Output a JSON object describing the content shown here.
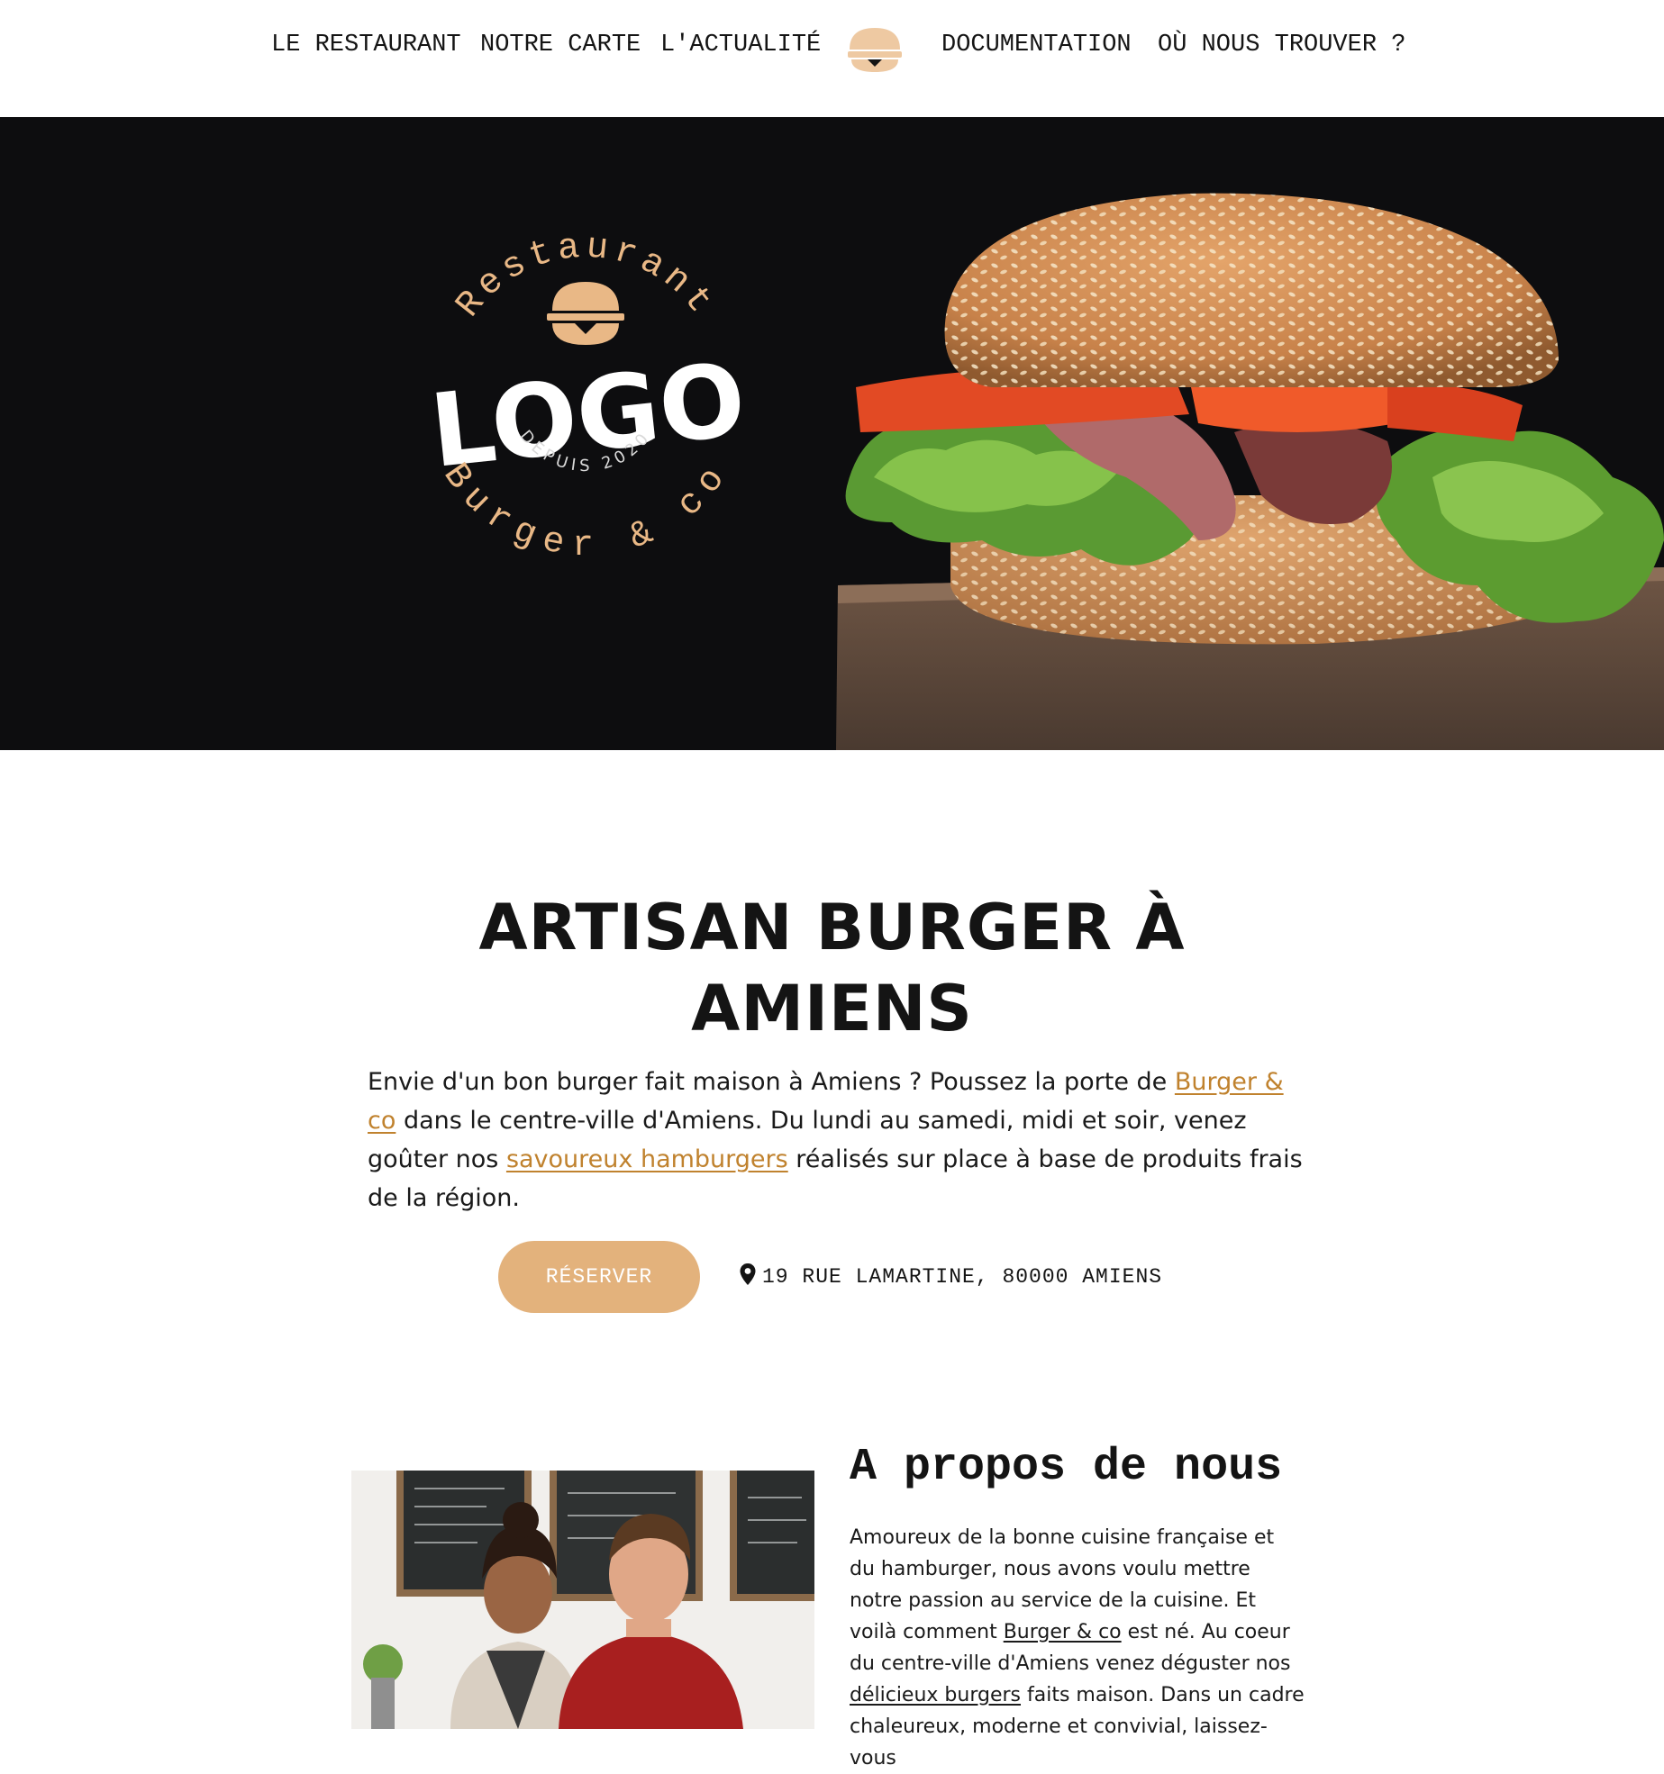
{
  "nav": {
    "items": [
      {
        "label": "LE RESTAURANT"
      },
      {
        "label": "NOTRE CARTE"
      },
      {
        "label": "L'ACTUALITÉ"
      },
      {
        "label": "DOCUMENTATION"
      },
      {
        "label": "OÙ NOUS TROUVER ?"
      }
    ],
    "logo_icon": "burger-icon"
  },
  "hero": {
    "logo": {
      "top_arc": "Restaurant",
      "main": "LOGO",
      "since": "DEPUIS 2020",
      "bottom_arc": "Burger & co"
    }
  },
  "intro": {
    "title_line1": "ARTISAN BURGER À",
    "title_line2": "AMIENS",
    "text_1": "Envie d'un bon burger fait maison à Amiens ? Poussez la porte de ",
    "link_1": "Burger & co",
    "text_2": " dans le centre-ville d'Amiens. Du lundi au samedi, midi et soir, venez goûter nos ",
    "link_2": "savoureux hamburgers",
    "text_3": " réalisés sur place à base de produits frais de la région.",
    "reserve_label": "RÉSERVER",
    "address_icon": "map-pin-icon",
    "address": "19 RUE LAMARTINE, 80000 AMIENS"
  },
  "about": {
    "title": "A propos de nous",
    "text_1": "Amoureux de la bonne cuisine française et du hamburger, nous avons voulu mettre notre passion au service de la cuisine. Et voilà comment ",
    "link_1": "Burger & co",
    "text_2": " est né. Au coeur du centre-ville d'Amiens venez déguster nos ",
    "link_2": "délicieux burgers",
    "text_3": " faits maison. Dans un cadre chaleureux, moderne et convivial, laissez-vous"
  },
  "colors": {
    "accent": "#e3b27c",
    "link": "#c0822e",
    "hero_bg": "#0d0d0f",
    "text": "#141414"
  }
}
